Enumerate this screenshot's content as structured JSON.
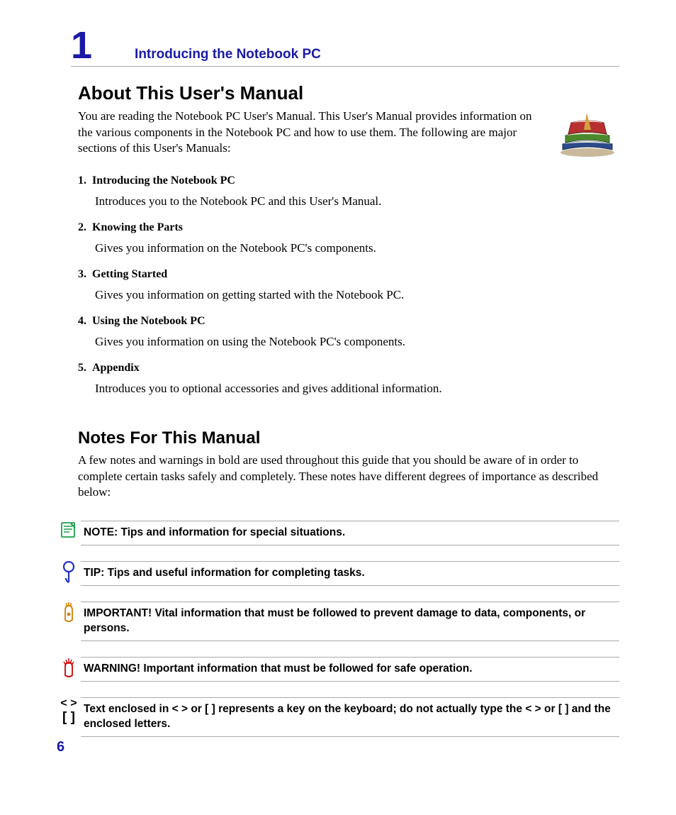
{
  "chapter": {
    "number": "1",
    "title": "Introducing the Notebook PC"
  },
  "section1": {
    "heading": "About This User's Manual",
    "intro": "You are reading the Notebook PC User's Manual. This User's Manual provides information on the various components in the Notebook PC and how to use them. The following are major sections of this User's Manuals:"
  },
  "sections": [
    {
      "num": "1.",
      "title": "Introducing the Notebook PC",
      "desc": "Introduces you to the Notebook PC and this User's Manual."
    },
    {
      "num": "2.",
      "title": "Knowing the Parts",
      "desc": "Gives you information on the Notebook PC's components."
    },
    {
      "num": "3.",
      "title": "Getting Started",
      "desc": "Gives you information on getting started with the Notebook PC."
    },
    {
      "num": "4.",
      "title": "Using the Notebook PC",
      "desc": "Gives you information on using the Notebook PC's components."
    },
    {
      "num": "5.",
      "title": "Appendix",
      "desc": "Introduces you to optional accessories and gives additional information."
    }
  ],
  "section2": {
    "heading": "Notes For This Manual",
    "intro": "A few notes and warnings in bold are used throughout this guide that you should be aware of in order to complete certain tasks safely and completely. These notes have different degrees of importance as described below:"
  },
  "callouts": {
    "note": "NOTE: Tips and information for special situations.",
    "tip": "TIP: Tips and useful information for completing tasks.",
    "important": "IMPORTANT! Vital information that must be followed to prevent damage to data, components, or persons.",
    "warning": "WARNING! Important information that must be followed for safe operation.",
    "keys": "Text enclosed in < > or [ ] represents a key on the keyboard; do not actually type the < > or [ ] and the enclosed letters.",
    "bracket_top": "< >",
    "bracket_bot": "[   ]"
  },
  "page_number": "6"
}
